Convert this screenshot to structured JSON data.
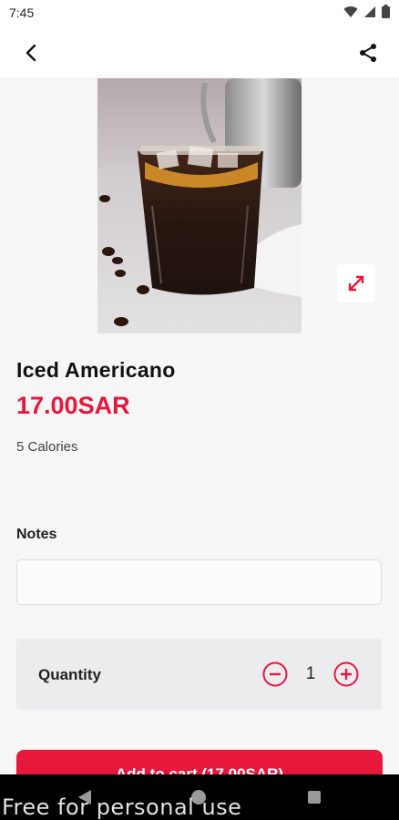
{
  "status_bar": {
    "time": "7:45",
    "icons": [
      "wifi-icon",
      "signal-icon",
      "battery-icon"
    ]
  },
  "app_bar": {
    "back_icon": "chevron-left-icon",
    "share_icon": "share-icon"
  },
  "product": {
    "name": "Iced Americano",
    "price": "17.00SAR",
    "calories": "5 Calories",
    "image_icon": "expand-icon"
  },
  "notes": {
    "label": "Notes",
    "value": "",
    "placeholder": ""
  },
  "quantity": {
    "label": "Quantity",
    "value": "1"
  },
  "cart": {
    "button_label": "Add to cart (17.00SAR)"
  },
  "system_nav": {
    "watermark": "Free for personal use"
  },
  "colors": {
    "accent": "#e8173c",
    "background": "#f6f6f7",
    "quantity_box": "#ececee"
  }
}
